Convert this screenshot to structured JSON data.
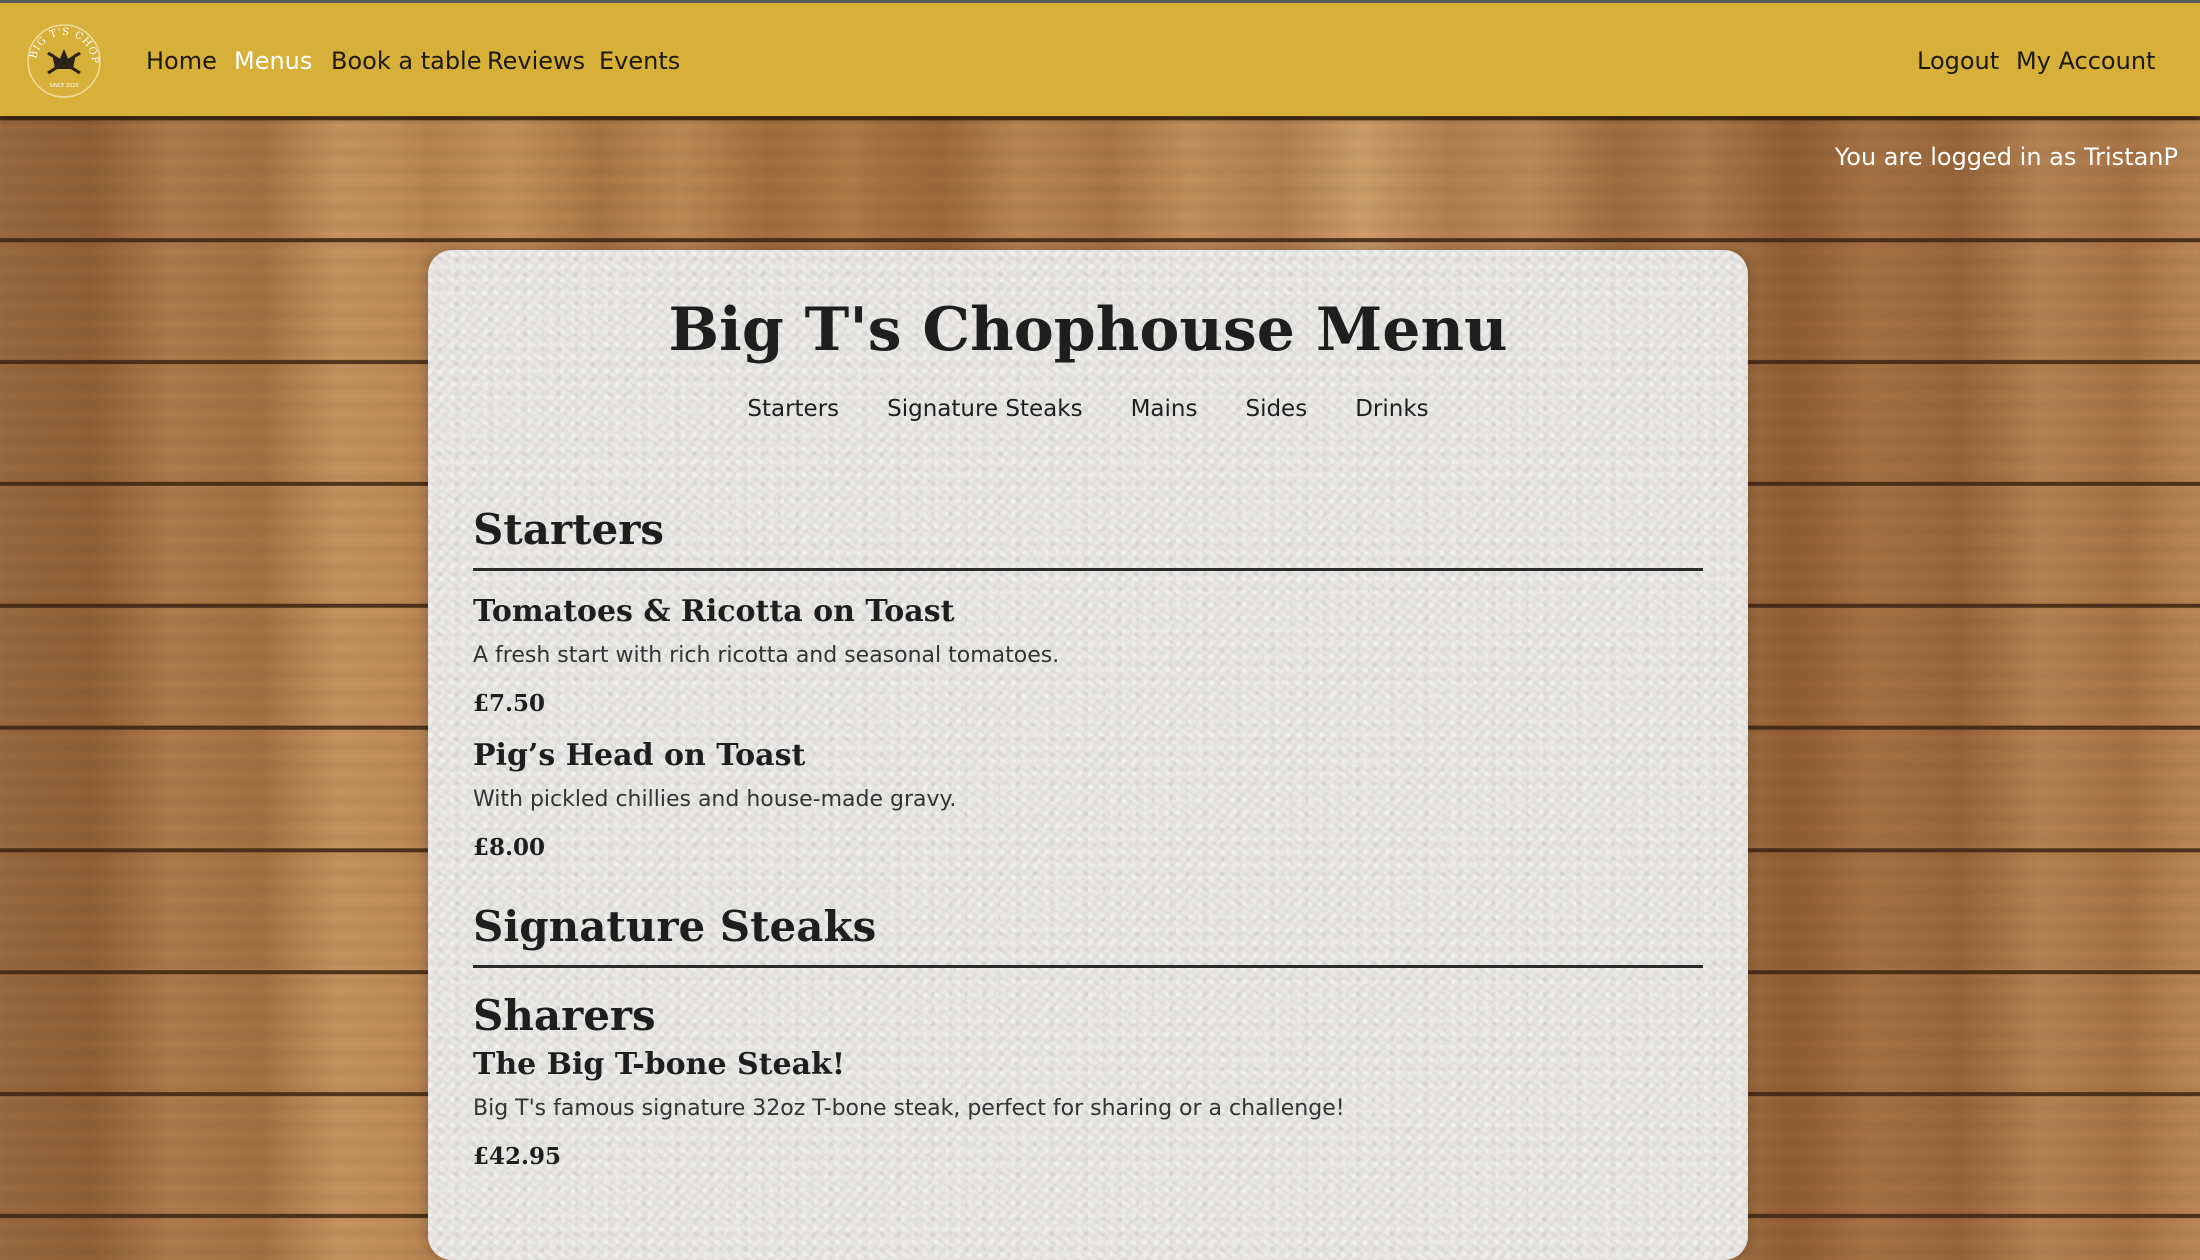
{
  "header": {
    "logo_text": "BIG T'S CHOPHOUSE",
    "logo_subtext": "SINCE 2020",
    "nav": [
      {
        "label": "Home"
      },
      {
        "label": "Menus"
      },
      {
        "label": "Book a table"
      },
      {
        "label": "Reviews"
      },
      {
        "label": "Events"
      }
    ],
    "logout_label": "Logout",
    "account_label": "My Account"
  },
  "login_status": "You are logged in as TristanP",
  "menu": {
    "title": "Big T's Chophouse Menu",
    "section_links": [
      "Starters",
      "Signature Steaks",
      "Mains",
      "Sides",
      "Drinks"
    ],
    "sections": [
      {
        "heading": "Starters",
        "items": [
          {
            "name": "Tomatoes & Ricotta on Toast",
            "description": "A fresh start with rich ricotta and seasonal tomatoes.",
            "price": "£7.50"
          },
          {
            "name": "Pig’s Head on Toast",
            "description": "With pickled chillies and house-made gravy.",
            "price": "£8.00"
          }
        ]
      },
      {
        "heading": "Signature Steaks",
        "subheading": "Sharers",
        "items": [
          {
            "name": "The Big T-bone Steak!",
            "description": "Big T's famous signature 32oz T-bone steak, perfect for sharing or a challenge!",
            "price": "£42.95"
          }
        ]
      }
    ]
  },
  "colors": {
    "header_bg": "#d6b038",
    "active_nav": "#ffffff",
    "card_bg": "#e8e6e3",
    "text": "#1e1e1e"
  }
}
